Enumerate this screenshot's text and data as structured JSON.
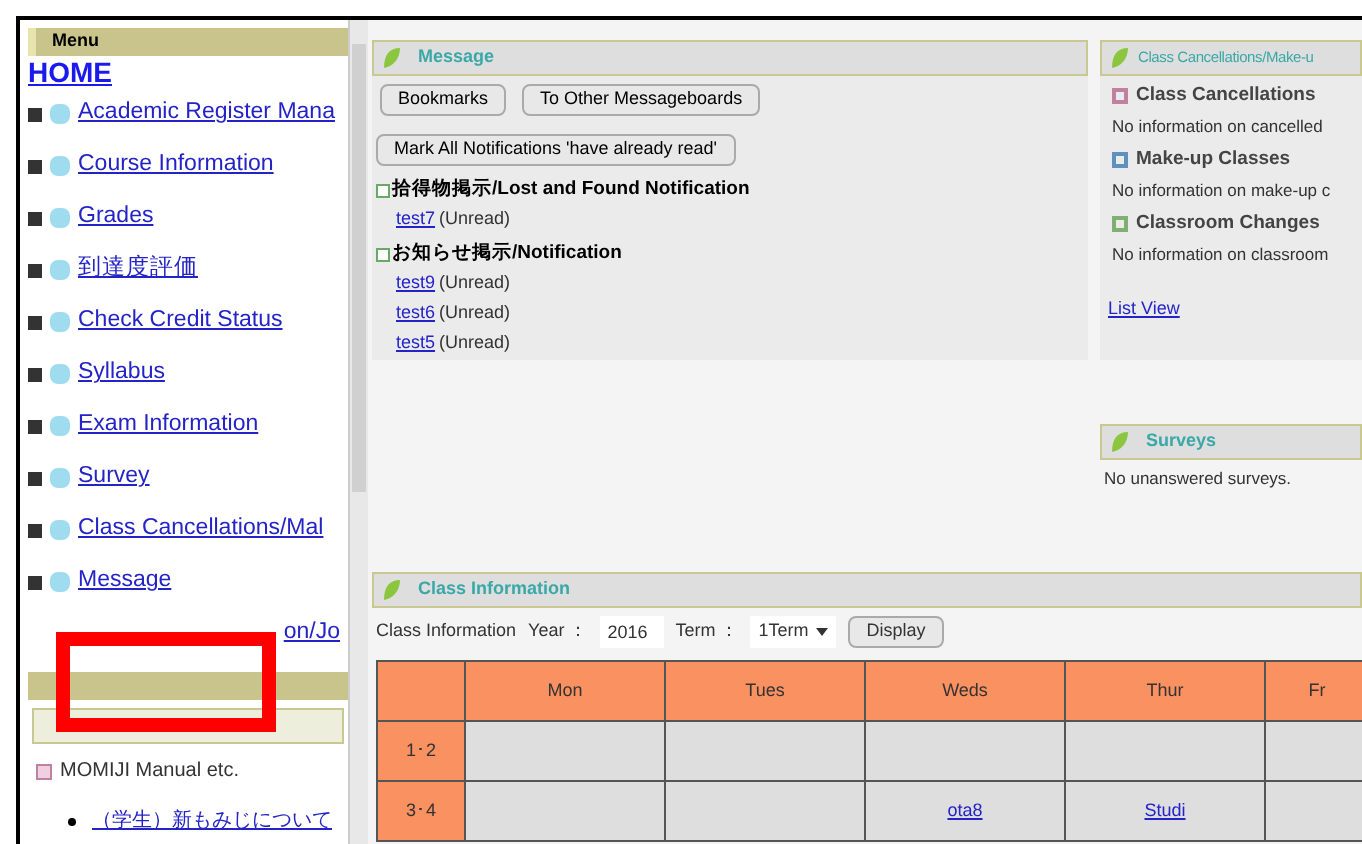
{
  "menu": {
    "title": "Menu",
    "home": "HOME",
    "items": [
      {
        "label": "Academic Register Mana"
      },
      {
        "label": "Course Information"
      },
      {
        "label": "Grades"
      },
      {
        "label": "到達度評価"
      },
      {
        "label": "Check Credit Status"
      },
      {
        "label": "Syllabus"
      },
      {
        "label": "Exam Information"
      },
      {
        "label": "Survey"
      },
      {
        "label": "Class Cancellations/Mal"
      },
      {
        "label": "Message"
      },
      {
        "label": "on/Jo"
      }
    ]
  },
  "links": {
    "section": "MOMIJI Manual etc.",
    "items": [
      "（学生）新もみじについて"
    ]
  },
  "message": {
    "title": "Message",
    "buttons": [
      "Bookmarks",
      "To Other Messageboards"
    ],
    "mark_all": "Mark All Notifications 'have already read'",
    "groups": [
      {
        "title": "拾得物掲示/Lost and Found Notification",
        "items": [
          {
            "link": "test7",
            "status": "(Unread)"
          }
        ]
      },
      {
        "title": "お知らせ掲示/Notification",
        "items": [
          {
            "link": "test9",
            "status": "(Unread)"
          },
          {
            "link": "test6",
            "status": "(Unread)"
          },
          {
            "link": "test5",
            "status": "(Unread)"
          }
        ]
      }
    ]
  },
  "cancellations": {
    "title": "Class Cancellations/Make-u",
    "sections": [
      {
        "title": "Class Cancellations",
        "text": "No information on cancelled",
        "color": "#c080a0"
      },
      {
        "title": "Make-up Classes",
        "text": "No information on make-up c",
        "color": "#6090c0"
      },
      {
        "title": "Classroom Changes",
        "text": "No information on classroom",
        "color": "#80b070"
      }
    ],
    "link": "List View"
  },
  "surveys": {
    "title": "Surveys",
    "text": "No unanswered surveys."
  },
  "class_info": {
    "title": "Class Information",
    "label": "Class Information",
    "year_label": "Year ：",
    "year": "2016",
    "term_label": "Term ：",
    "term": "1Term",
    "button": "Display",
    "columns": [
      "Mon",
      "Tues",
      "Weds",
      "Thur",
      "Fr"
    ],
    "rows": [
      {
        "period": "1･2",
        "cells": [
          "",
          "",
          "",
          "",
          ""
        ]
      },
      {
        "period": "3･4",
        "cells": [
          "",
          "",
          "ota8",
          "Studi",
          ""
        ]
      }
    ]
  }
}
